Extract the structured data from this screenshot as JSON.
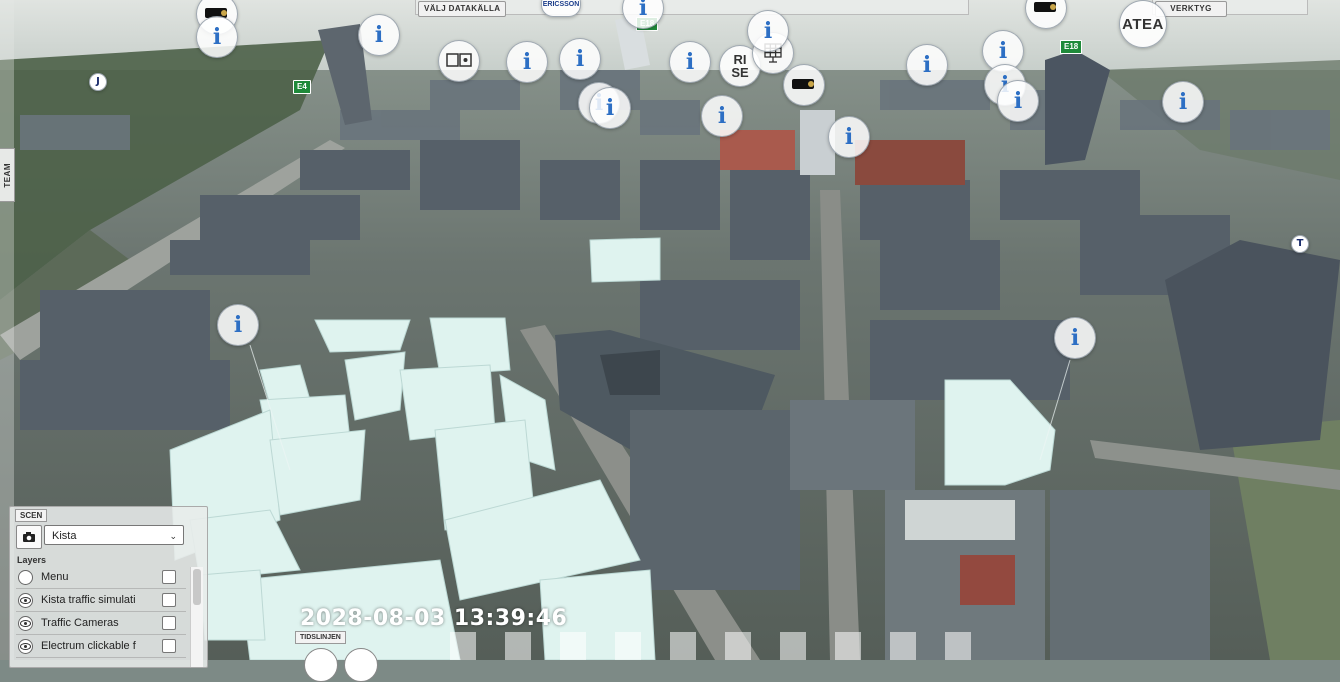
{
  "top_bar": {
    "data_source_button": "VÄLJ DATAKÄLLA",
    "tools_button": "VERKTYG"
  },
  "team_tab": {
    "label": "TEAM"
  },
  "road_signs": [
    "E4",
    "E18",
    "E18"
  ],
  "markers": {
    "ericsson_label": "ERICSSON",
    "rise_logo": "RI SE",
    "atea_logo": "ATEA"
  },
  "scen_panel": {
    "title": "SCEN",
    "selected_scene": "Kista",
    "layers_title": "Layers",
    "layers": [
      {
        "label": "Menu",
        "visibility": "radio"
      },
      {
        "label": "Kista traffic simulati",
        "visibility": "eye"
      },
      {
        "label": "Traffic Cameras",
        "visibility": "eye"
      },
      {
        "label": "Electrum clickable f",
        "visibility": "eye"
      }
    ]
  },
  "timeline": {
    "timestamp": "2028-08-03 13:39:46",
    "label": "TIDSLINJEN"
  },
  "colors": {
    "info_icon": "#2d6fc4",
    "road_sign": "#1f8a3a",
    "planned_buildings": "#dff3ef"
  }
}
